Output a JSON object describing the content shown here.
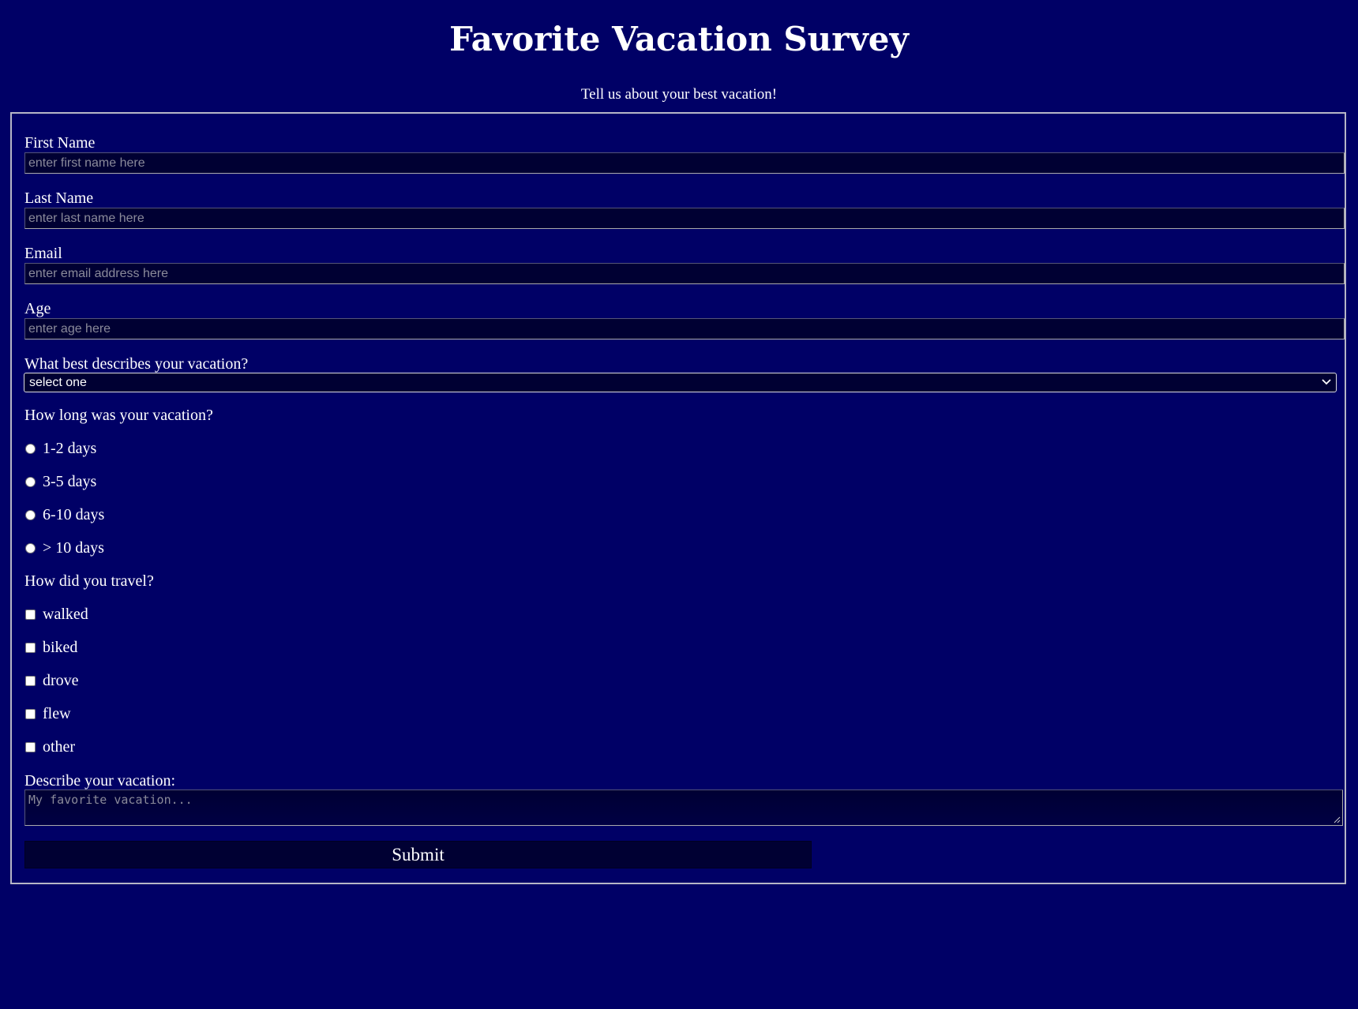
{
  "page": {
    "title": "Favorite Vacation Survey",
    "description": "Tell us about your best vacation!"
  },
  "form": {
    "first_name": {
      "label": "First Name",
      "placeholder": "enter first name here"
    },
    "last_name": {
      "label": "Last Name",
      "placeholder": "enter last name here"
    },
    "email": {
      "label": "Email",
      "placeholder": "enter email address here"
    },
    "age": {
      "label": "Age",
      "placeholder": "enter age here"
    },
    "vacation_type": {
      "label": "What best describes your vacation?",
      "selected": "select one"
    },
    "duration": {
      "label": "How long was your vacation?",
      "options": [
        "1-2 days",
        "3-5 days",
        "6-10 days",
        "> 10 days"
      ]
    },
    "travel": {
      "label": "How did you travel?",
      "options": [
        "walked",
        "biked",
        "drove",
        "flew",
        "other"
      ]
    },
    "description": {
      "label": "Describe your vacation:",
      "placeholder": "My favorite vacation..."
    },
    "submit_label": "Submit"
  },
  "colors": {
    "background": "#000066",
    "input_background": "#000033",
    "text": "#ffffff",
    "border": "#b6b6c6"
  },
  "icons": {
    "select_arrow": "chevron-down-icon",
    "textarea_resize": "resize-grip-icon"
  }
}
